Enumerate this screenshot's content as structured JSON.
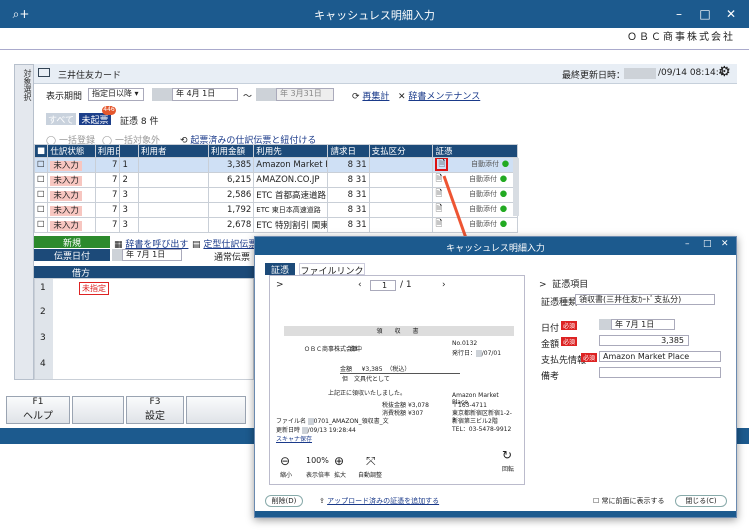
{
  "app": {
    "title": "キャッシュレス明細入力",
    "company": "ＯＢＣ商事株式会社"
  },
  "side": {
    "label": "対象選択"
  },
  "card": {
    "name": "三井住友カード",
    "updated_label": "最終更新日時：",
    "updated_value": "/09/14 08:14:47"
  },
  "filter": {
    "period_label": "表示期間",
    "period_select": "指定日以降",
    "year1": "年",
    "date1": " 4月 1日",
    "wave": "～",
    "date2": "年 3月31日",
    "recalc": "再集計",
    "dict": "辞書メンテナンス"
  },
  "status": {
    "all": "すべて",
    "unposted": "未起票",
    "badge": "446",
    "count": "証憑 8 件"
  },
  "actions": {
    "bulk_register": "一括登録",
    "bulk_exclude": "一括対象外",
    "link": "起票済みの仕訳伝票と紐付ける"
  },
  "columns": [
    "",
    "仕訳状態",
    "利用日",
    "",
    "利用者",
    "利用金額",
    "利用先",
    "請求日",
    "支払区分",
    "証憑"
  ],
  "rows": [
    {
      "state": "未入力",
      "m": "7",
      "d": "1",
      "amount": "3,385",
      "dest": "Amazon Market Place",
      "bm": "8",
      "bd": "31",
      "auto": "自動添付"
    },
    {
      "state": "未入力",
      "m": "7",
      "d": "2",
      "amount": "6,215",
      "dest": "AMAZON.CO.JP",
      "bm": "8",
      "bd": "31",
      "auto": "自動添付"
    },
    {
      "state": "未入力",
      "m": "7",
      "d": "3",
      "amount": "2,586",
      "dest": "ETC 首都高速道路",
      "bm": "8",
      "bd": "31",
      "auto": "自動添付"
    },
    {
      "state": "未入力",
      "m": "7",
      "d": "3",
      "amount": "1,792",
      "dest": "ETC 東日本高速道路",
      "bm": "8",
      "bd": "31",
      "auto": "自動添付"
    },
    {
      "state": "未入力",
      "m": "7",
      "d": "3",
      "amount": "2,678",
      "dest": "ETC 特別割引 関東",
      "bm": "8",
      "bd": "31",
      "auto": "自動添付"
    }
  ],
  "entry": {
    "new": "新規",
    "date_label": "伝票日付",
    "dict_call": "辞書を呼び出す",
    "fixed": "定型仕訳伝票",
    "date_val": "年 7月 1日",
    "type": "通常伝票",
    "debit": "借方",
    "unspecified": "未指定"
  },
  "fkeys": [
    {
      "k": "F1",
      "l": "ヘルプ"
    },
    {
      "k": "",
      "l": ""
    },
    {
      "k": "F3",
      "l": "設定"
    },
    {
      "k": "",
      "l": ""
    }
  ],
  "modal": {
    "title": "キャッシュレス明細入力",
    "tab1": "証憑",
    "tab2": "ファイルリンク",
    "page": "1",
    "of": "/ 1",
    "section": "証憑項目",
    "kind_label": "証憑種類",
    "kind_val": "領収書(三井住友ｶｰﾄﾞ支払分)",
    "date_label": "日付",
    "req": "必須",
    "date_val": "年 7月 1日",
    "amount_label": "金額",
    "amount_val": "3,385",
    "dest_label": "支払先情報",
    "dest_val": "Amazon Market Place",
    "memo_label": "備考",
    "zoom_out": "縮小",
    "zoom": "100%",
    "fit": "表示倍率",
    "zoom_in": "拡大",
    "auto_adj": "自動調整",
    "rotate": "回転",
    "del": "削除(D)",
    "add_link": "アップロード済みの証憑を追加する",
    "front": "常に前面に表示する",
    "close": "閉じる(C)",
    "filename": "ファイル名",
    "file_val": "0701_AMAZON_領収書_文",
    "updated": "更新日時",
    "updated_val": "/09/13 19:28:44",
    "scan": "スキャナ保存"
  },
  "receipt": {
    "title": "領　収　書",
    "to": "ＯＢＣ商事株式会社",
    "sama": "御中",
    "no": "No.0132",
    "issue": "発行日：",
    "issue_d": "/07/01",
    "amount_label": "金額",
    "amount": "¥3,385",
    "tax": "（税込）",
    "tadashi": "但　文具代として",
    "recv": "上記正に領収いたしました。",
    "price_l": "税抜金額",
    "price": "¥3,078",
    "cons_l": "消費税額",
    "cons": "¥307",
    "biz": "Amazon Market Place",
    "zip": "〒163-4711",
    "addr": "東京都新宿区新宿1-2-3",
    "bldg": "新宿第三ビル2階",
    "tel": "TEL：03-5478-9912"
  }
}
